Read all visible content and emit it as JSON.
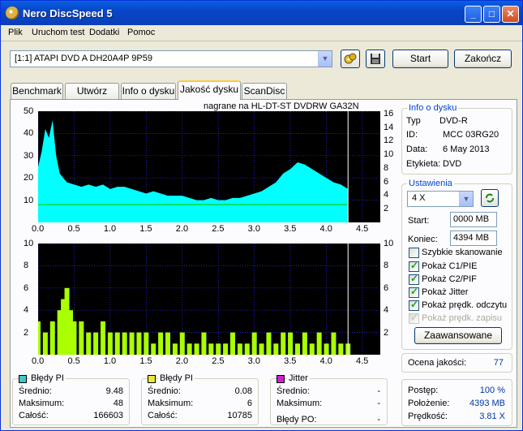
{
  "window": {
    "title": "Nero DiscSpeed 5"
  },
  "menu": [
    "Plik",
    "Uruchom test",
    "Dodatki",
    "Pomoc"
  ],
  "toolbar": {
    "drive": "[1:1]   ATAPI DVD A  DH20A4P 9P59",
    "start_label": "Start",
    "end_label": "Zakończ"
  },
  "tabs": [
    "Benchmark",
    "Utwórz dysk",
    "Info o dysku",
    "Jakość dysku",
    "ScanDisc"
  ],
  "active_tab": "Jakość dysku",
  "chart_caption": "nagrane na HL-DT-ST DVDRW  GA32N",
  "disc_info": {
    "title": "Info o dysku",
    "type_label": "Typ",
    "type_value": "DVD-R",
    "id_label": "ID:",
    "id_value": "MCC 03RG20",
    "date_label": "Data:",
    "date_value": "6 May 2013",
    "label_label": "Etykieta:",
    "label_value": "DVD"
  },
  "settings": {
    "title": "Ustawienia",
    "speed": "4 X",
    "start_label": "Start:",
    "start_value": "0000 MB",
    "end_label": "Koniec:",
    "end_value": "4394 MB",
    "checkboxes": [
      {
        "label": "Szybkie skanowanie",
        "checked": false,
        "disabled": false
      },
      {
        "label": "Pokaż C1/PIE",
        "checked": true,
        "disabled": false
      },
      {
        "label": "Pokaż C2/PIF",
        "checked": true,
        "disabled": false
      },
      {
        "label": "Pokaż Jitter",
        "checked": true,
        "disabled": false
      },
      {
        "label": "Pokaż prędk. odczytu",
        "checked": true,
        "disabled": false
      },
      {
        "label": "Pokaż prędk. zapisu",
        "checked": true,
        "disabled": true
      }
    ],
    "advanced_label": "Zaawansowane"
  },
  "quality": {
    "label": "Ocena jakości:",
    "value": "77"
  },
  "progress": {
    "progress_label": "Postęp:",
    "progress_value": "100 %",
    "position_label": "Położenie:",
    "position_value": "4393 MB",
    "speed_label": "Prędkość:",
    "speed_value": "3.81 X"
  },
  "stats": {
    "pi": {
      "title": "Błędy PI",
      "color": "#40C8C8",
      "avg_label": "Średnio:",
      "avg": "9.48",
      "max_label": "Maksimum:",
      "max": "48",
      "total_label": "Całość:",
      "total": "166603"
    },
    "pif": {
      "title": "Błędy PI",
      "color": "#E8E840",
      "avg_label": "Średnio:",
      "avg": "0.08",
      "max_label": "Maksimum:",
      "max": "6",
      "total_label": "Całość:",
      "total": "10785"
    },
    "jitter": {
      "title": "Jitter",
      "color": "#D020D0",
      "avg_label": "Średnio:",
      "avg": "-",
      "max_label": "Maksimum:",
      "max": "-",
      "po_label": "Błędy PO:",
      "po": "-"
    }
  },
  "colors": {
    "pie_fill": "#00FFFF",
    "pif_fill": "#AAFF00",
    "speed_line": "#00CC00",
    "grid": "#3030FF",
    "plot_bg": "#000000"
  },
  "chart_data": [
    {
      "type": "area",
      "name": "PI errors",
      "x_ticks": [
        "0.0",
        "0.5",
        "1.0",
        "1.5",
        "2.0",
        "2.5",
        "3.0",
        "3.5",
        "4.0",
        "4.5"
      ],
      "y_ticks_left": [
        "50",
        "40",
        "30",
        "20",
        "10"
      ],
      "y_ticks_right": [
        "16",
        "14",
        "12",
        "10",
        "8",
        "6",
        "4",
        "2"
      ],
      "xlim": [
        0,
        4.5
      ],
      "ylim": [
        0,
        50
      ],
      "x": [
        0.0,
        0.05,
        0.1,
        0.15,
        0.2,
        0.25,
        0.3,
        0.4,
        0.5,
        0.6,
        0.7,
        0.8,
        0.9,
        1.0,
        1.1,
        1.2,
        1.3,
        1.4,
        1.5,
        1.6,
        1.7,
        1.8,
        1.9,
        2.0,
        2.1,
        2.2,
        2.3,
        2.4,
        2.5,
        2.6,
        2.7,
        2.8,
        2.9,
        3.0,
        3.1,
        3.2,
        3.3,
        3.4,
        3.5,
        3.6,
        3.7,
        3.8,
        3.9,
        4.0,
        4.1,
        4.2,
        4.3
      ],
      "y": [
        25,
        32,
        42,
        38,
        46,
        30,
        22,
        18,
        17,
        16,
        17,
        16,
        17,
        15,
        16,
        16,
        15,
        14,
        13,
        14,
        13,
        12,
        12,
        12,
        11,
        10,
        10,
        11,
        10,
        10,
        11,
        11,
        12,
        13,
        14,
        16,
        18,
        22,
        24,
        27,
        26,
        24,
        22,
        20,
        18,
        17,
        15
      ],
      "speed_line_y": 8
    },
    {
      "type": "bar",
      "name": "PIF errors",
      "x_ticks": [
        "0.0",
        "0.5",
        "1.0",
        "1.5",
        "2.0",
        "2.5",
        "3.0",
        "3.5",
        "4.0",
        "4.5"
      ],
      "y_ticks_left": [
        "10",
        "8",
        "6",
        "4",
        "2"
      ],
      "y_ticks_right": [
        "10",
        "8",
        "6",
        "4",
        "2"
      ],
      "xlim": [
        0,
        4.5
      ],
      "ylim": [
        0,
        10
      ],
      "x": [
        0.0,
        0.1,
        0.2,
        0.3,
        0.35,
        0.4,
        0.45,
        0.5,
        0.6,
        0.7,
        0.8,
        0.9,
        1.0,
        1.1,
        1.2,
        1.3,
        1.4,
        1.5,
        1.6,
        1.7,
        1.8,
        1.9,
        2.0,
        2.1,
        2.2,
        2.3,
        2.4,
        2.5,
        2.6,
        2.7,
        2.8,
        2.9,
        3.0,
        3.1,
        3.2,
        3.3,
        3.4,
        3.5,
        3.6,
        3.7,
        3.8,
        3.9,
        4.0,
        4.1,
        4.2,
        4.3
      ],
      "y": [
        3,
        2,
        3,
        4,
        5,
        6,
        4,
        3,
        3,
        2,
        2,
        3,
        2,
        2,
        2,
        2,
        2,
        2,
        1,
        2,
        2,
        1,
        2,
        1,
        1,
        2,
        1,
        1,
        1,
        2,
        1,
        1,
        2,
        1,
        2,
        1,
        2,
        2,
        1,
        2,
        1,
        2,
        1,
        2,
        1,
        1
      ]
    }
  ]
}
